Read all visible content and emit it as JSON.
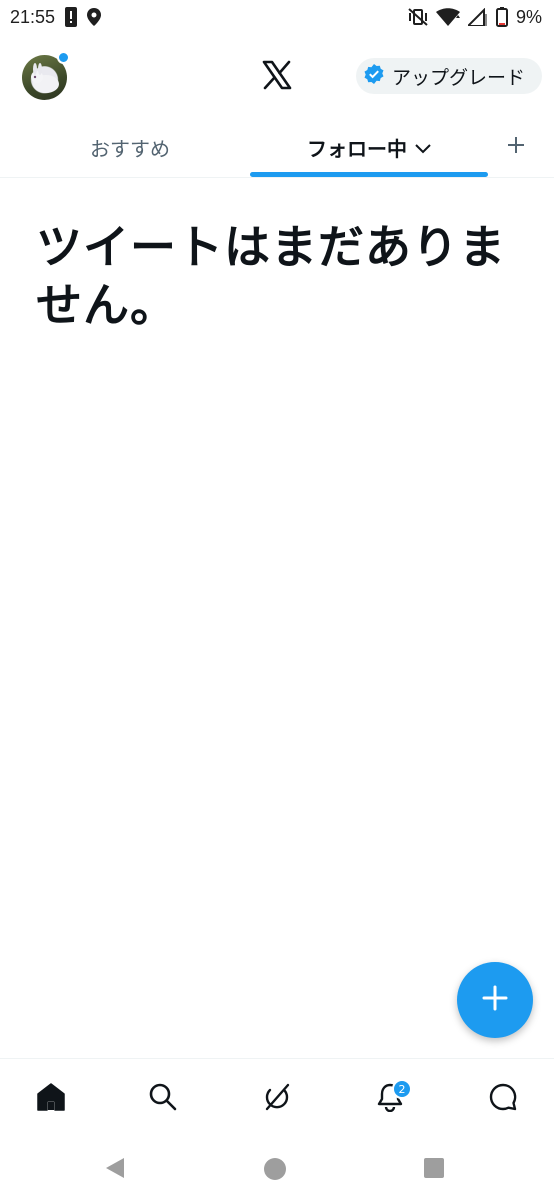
{
  "status_bar": {
    "time": "21:55",
    "battery_text": "9%",
    "icons": [
      "alert-icon",
      "location-icon",
      "vibrate-off-icon",
      "wifi-icon",
      "signal-icon",
      "battery-icon"
    ]
  },
  "header": {
    "logo": "x-logo-icon",
    "upgrade_label": "アップグレード",
    "verified_badge_color": "#1d9bf0"
  },
  "tabs": {
    "items": [
      {
        "label": "おすすめ",
        "active": false
      },
      {
        "label": "フォロー中",
        "active": true
      }
    ],
    "add_icon": "plus-icon",
    "accent": "#1d9bf0"
  },
  "main": {
    "empty_title": "ツイートはまだありません。"
  },
  "fab": {
    "icon": "plus-icon",
    "color": "#1d9bf0"
  },
  "bottom_nav": {
    "items": [
      "home-icon",
      "search-icon",
      "grok-icon",
      "notifications-icon",
      "messages-icon"
    ],
    "notification_count": "2"
  },
  "system_nav": {
    "items": [
      "back-icon",
      "home-icon",
      "recents-icon"
    ]
  }
}
